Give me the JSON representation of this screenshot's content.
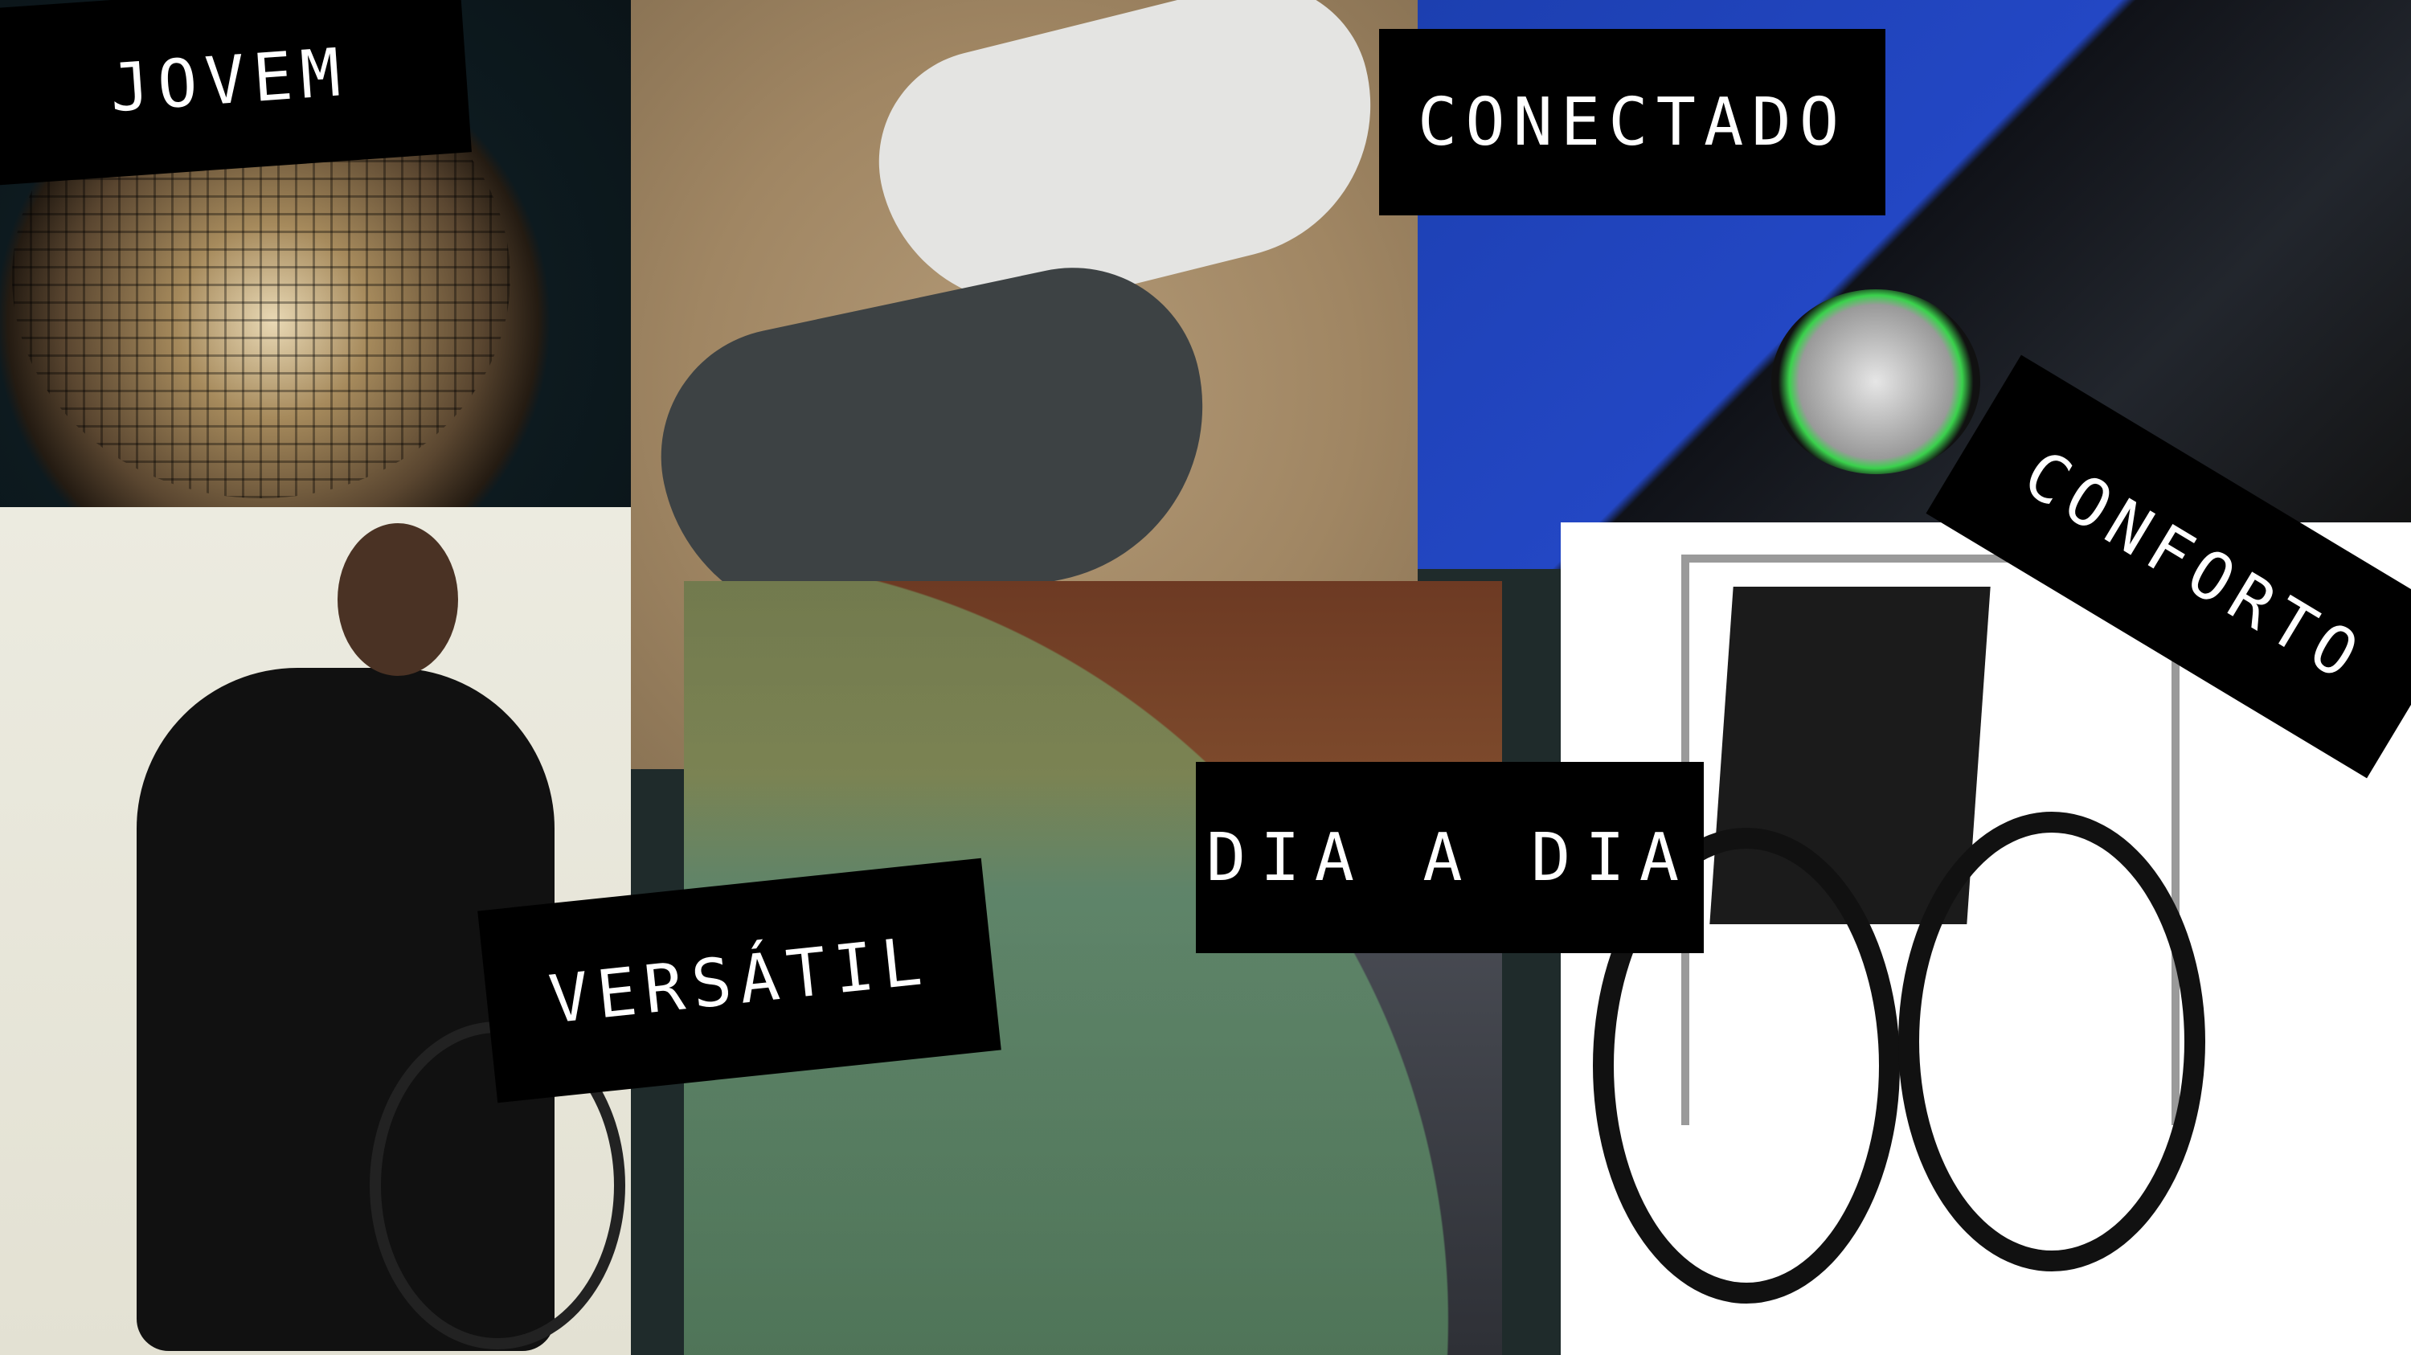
{
  "labels": {
    "jovem": "JOVEM",
    "conectado": "CONECTADO",
    "conforto": "CONFORTO",
    "versatil": "VERSÁTIL",
    "dia_a_dia": "DIA A DIA"
  },
  "colors": {
    "label_background": "#000000",
    "label_text": "#ffffff",
    "page_background": "#1f2b2b"
  }
}
